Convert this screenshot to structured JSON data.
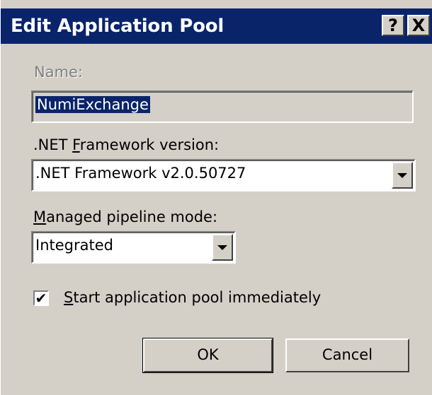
{
  "window": {
    "title": "Edit Application Pool",
    "help_glyph": "?",
    "close_glyph": "X"
  },
  "name": {
    "label": "Name:",
    "value": "NumiExchange"
  },
  "framework": {
    "label_prefix": ".NET ",
    "label_mnemonic": "F",
    "label_suffix": "ramework version:",
    "selected": ".NET Framework v2.0.50727"
  },
  "pipeline": {
    "label_mnemonic": "M",
    "label_suffix": "anaged pipeline mode:",
    "selected": "Integrated"
  },
  "start_immediately": {
    "checked_glyph": "✔",
    "label_mnemonic": "S",
    "label_suffix": "tart application pool immediately"
  },
  "buttons": {
    "ok": "OK",
    "cancel": "Cancel"
  },
  "colors": {
    "titlebar": "#0a246a",
    "dialog_bg": "#d4d0c8"
  }
}
